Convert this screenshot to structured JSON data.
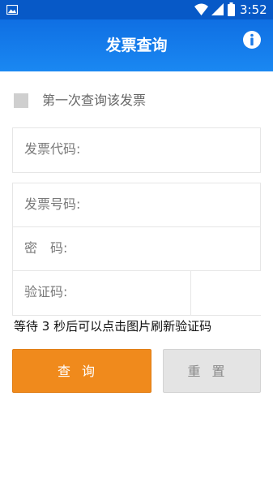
{
  "status_bar": {
    "time": "3:52",
    "icons": [
      "photo-icon",
      "wifi-icon",
      "signal-icon",
      "battery-icon"
    ]
  },
  "app_bar": {
    "title": "发票查询",
    "info_icon": "info-icon",
    "color": "#1a7ae8"
  },
  "first_query": {
    "label": "第一次查询该发票",
    "checked": false
  },
  "form": {
    "invoice_code_label": "发票代码:",
    "invoice_code_value": "",
    "invoice_number_label": "发票号码:",
    "invoice_number_value": "",
    "password_label": "密　码:",
    "password_value": "",
    "captcha_label": "验证码:",
    "captcha_value": ""
  },
  "hint": "等待 3 秒后可以点击图片刷新验证码",
  "buttons": {
    "query_label": "查询",
    "reset_label": "重置",
    "query_color": "#f08a1c",
    "reset_color": "#e4e4e4"
  }
}
